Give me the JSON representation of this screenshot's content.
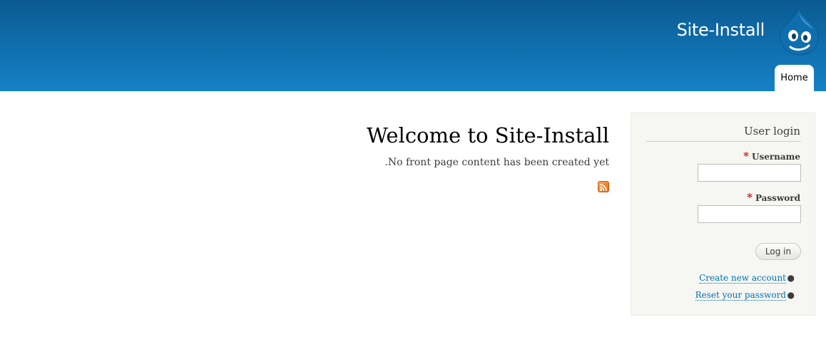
{
  "header": {
    "site_name": "Site-Install",
    "logo_icon": "drupal-drop-icon",
    "tabs": [
      {
        "label": "Home",
        "active": true
      }
    ]
  },
  "main": {
    "title": "Welcome to Site-Install",
    "empty_text": ".No front page content has been created yet",
    "feed_icon": "rss-feed-icon"
  },
  "sidebar": {
    "user_login": {
      "title": "User login",
      "username_label": "Username",
      "password_label": "Password",
      "required_marker": "*",
      "username_value": "",
      "password_value": "",
      "submit_label": "Log in",
      "links": [
        {
          "label": "Create new account"
        },
        {
          "label": "Reset your password"
        }
      ]
    }
  },
  "colors": {
    "header_top": "#0b5a92",
    "header_bottom": "#1582c6",
    "link": "#0071b3",
    "required": "#cc1b1b",
    "sidebar_bg": "#f6f6f2"
  }
}
